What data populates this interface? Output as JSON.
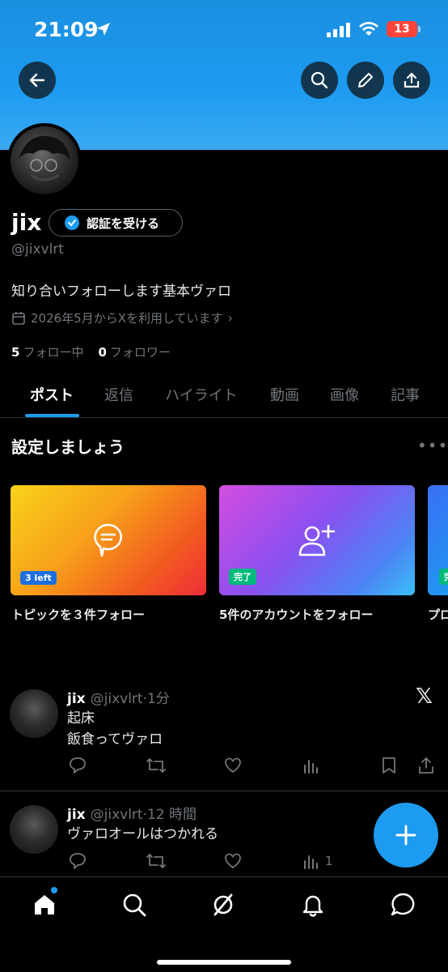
{
  "status": {
    "time": "21:09",
    "battery": "13"
  },
  "profile": {
    "name": "jix",
    "verify_label": "認証を受ける",
    "handle": "@jixvlrt",
    "bio": "知り合いフォローします基本ヴァロ",
    "joined": "2026年5月からXを利用しています",
    "following_count": "5",
    "following_label": "フォロー中",
    "followers_count": "0",
    "followers_label": "フォロワー"
  },
  "tabs": [
    "ポスト",
    "返信",
    "ハイライト",
    "動画",
    "画像",
    "記事"
  ],
  "setup": {
    "title": "設定しましょう",
    "cards": [
      {
        "badge": "3 left",
        "label": "トピックを３件フォロー"
      },
      {
        "badge": "完了",
        "label": "5件のアカウントをフォロー"
      },
      {
        "badge": "完",
        "label": "プロ"
      }
    ]
  },
  "posts": [
    {
      "name": "jix",
      "handle": "@jixvlrt",
      "time": "·1分",
      "lines": [
        "起床",
        "飯食ってヴァロ"
      ],
      "views": ""
    },
    {
      "name": "jix",
      "handle": "@jixvlrt",
      "time": "·12 時間",
      "lines": [
        "ヴァロオールはつかれる"
      ],
      "views": "1"
    }
  ],
  "colors": {
    "accent": "#1d9bf0",
    "banner": "#1d9bf0",
    "background": "#000000",
    "muted": "#71767b"
  }
}
